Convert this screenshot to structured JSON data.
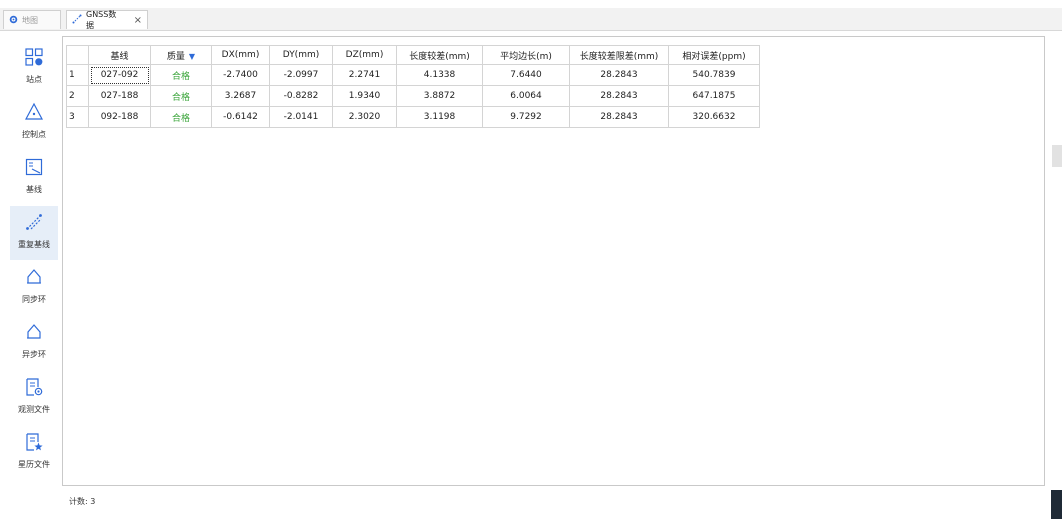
{
  "tabs": [
    {
      "label": "地图",
      "icon": "gear-icon"
    },
    {
      "label": "GNSS数据",
      "icon": "baseline-icon",
      "close": "×"
    }
  ],
  "sidebar": {
    "items": [
      {
        "label": "站点",
        "icon": "station-icon"
      },
      {
        "label": "控制点",
        "icon": "control-point-icon"
      },
      {
        "label": "基线",
        "icon": "baseline-list-icon"
      },
      {
        "label": "重复基线",
        "icon": "repeat-baseline-icon"
      },
      {
        "label": "同步环",
        "icon": "sync-loop-icon"
      },
      {
        "label": "异步环",
        "icon": "async-loop-icon"
      },
      {
        "label": "观测文件",
        "icon": "observation-file-icon"
      },
      {
        "label": "星历文件",
        "icon": "ephemeris-file-icon"
      }
    ],
    "selected": "重复基线"
  },
  "table": {
    "headers": [
      "",
      "基线",
      "质量",
      "DX(mm)",
      "DY(mm)",
      "DZ(mm)",
      "长度较差(mm)",
      "平均边长(m)",
      "长度较差限差(mm)",
      "相对误差(ppm)"
    ],
    "rows": [
      [
        "1",
        "027-092",
        "合格",
        "-2.7400",
        "-2.0997",
        "2.2741",
        "4.1338",
        "7.6440",
        "28.2843",
        "540.7839"
      ],
      [
        "2",
        "027-188",
        "合格",
        "3.2687",
        "-0.8282",
        "1.9340",
        "3.8872",
        "6.0064",
        "28.2843",
        "647.1875"
      ],
      [
        "3",
        "092-188",
        "合格",
        "-0.6142",
        "-2.0141",
        "2.3020",
        "3.1198",
        "9.7292",
        "28.2843",
        "320.6632"
      ]
    ]
  },
  "status": {
    "count_text": "计数: 3"
  },
  "colors": {
    "ok": "#3aa53a",
    "accent": "#2f6bd8",
    "selected_bg": "#e6eef8"
  }
}
